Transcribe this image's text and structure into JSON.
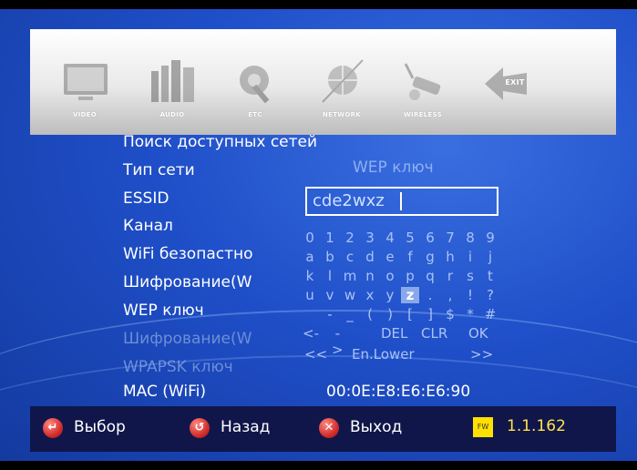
{
  "menu": {
    "items": [
      {
        "label": "VIDEO",
        "icon": "tv-icon"
      },
      {
        "label": "AUDIO",
        "icon": "speakers-icon"
      },
      {
        "label": "ETC",
        "icon": "gear-wrench-icon"
      },
      {
        "label": "NETWORK",
        "icon": "globe-cable-icon"
      },
      {
        "label": "WIRELESS",
        "icon": "wireless-router-icon"
      },
      {
        "label": "EXIT",
        "icon": "exit-arrow-icon"
      }
    ]
  },
  "settings": {
    "search": "Поиск доступных сетей",
    "net_type": "Тип сети",
    "net_type_value": "WEP ключ",
    "essid": "ESSID",
    "essid_value": "cde2wxz",
    "channel": "Канал",
    "wifi_security": "WiFi безопастно",
    "encryption": "Шифрование(W",
    "wep_key": "WEP ключ",
    "encryption_disabled": "Шифрование(W",
    "wpapsk_key": "WPAPSK ключ",
    "mac_label": "MAC (WiFi)",
    "mac_value": "00:0E:E8:E6:E6:90"
  },
  "keyboard": {
    "row1": [
      "0",
      "1",
      "2",
      "3",
      "4",
      "5",
      "6",
      "7",
      "8",
      "9"
    ],
    "row2": [
      "a",
      "b",
      "c",
      "d",
      "e",
      "f",
      "g",
      "h",
      "i",
      "j"
    ],
    "row3": [
      "k",
      "l",
      "m",
      "n",
      "o",
      "p",
      "q",
      "r",
      "s",
      "t"
    ],
    "row4": [
      "u",
      "v",
      "w",
      "x",
      "y",
      "z",
      ".",
      ",",
      "!",
      "?"
    ],
    "row5": [
      "-",
      "_",
      "(",
      ")",
      "[",
      "]",
      "$",
      "*",
      "#"
    ],
    "row6": [
      "<-",
      "->",
      "DEL",
      "CLR",
      "OK"
    ],
    "row7": [
      "<<",
      "En.Lower",
      ">>"
    ],
    "selected_key": "z"
  },
  "bottom": {
    "select": "Выбор",
    "back": "Назад",
    "exit": "Выход",
    "fw_badge": "FW",
    "fw_version": "1.1.162"
  },
  "colors": {
    "background": "#1f4fc9",
    "bottom_bar": "#10164a",
    "fw_version": "#ffe24a"
  }
}
